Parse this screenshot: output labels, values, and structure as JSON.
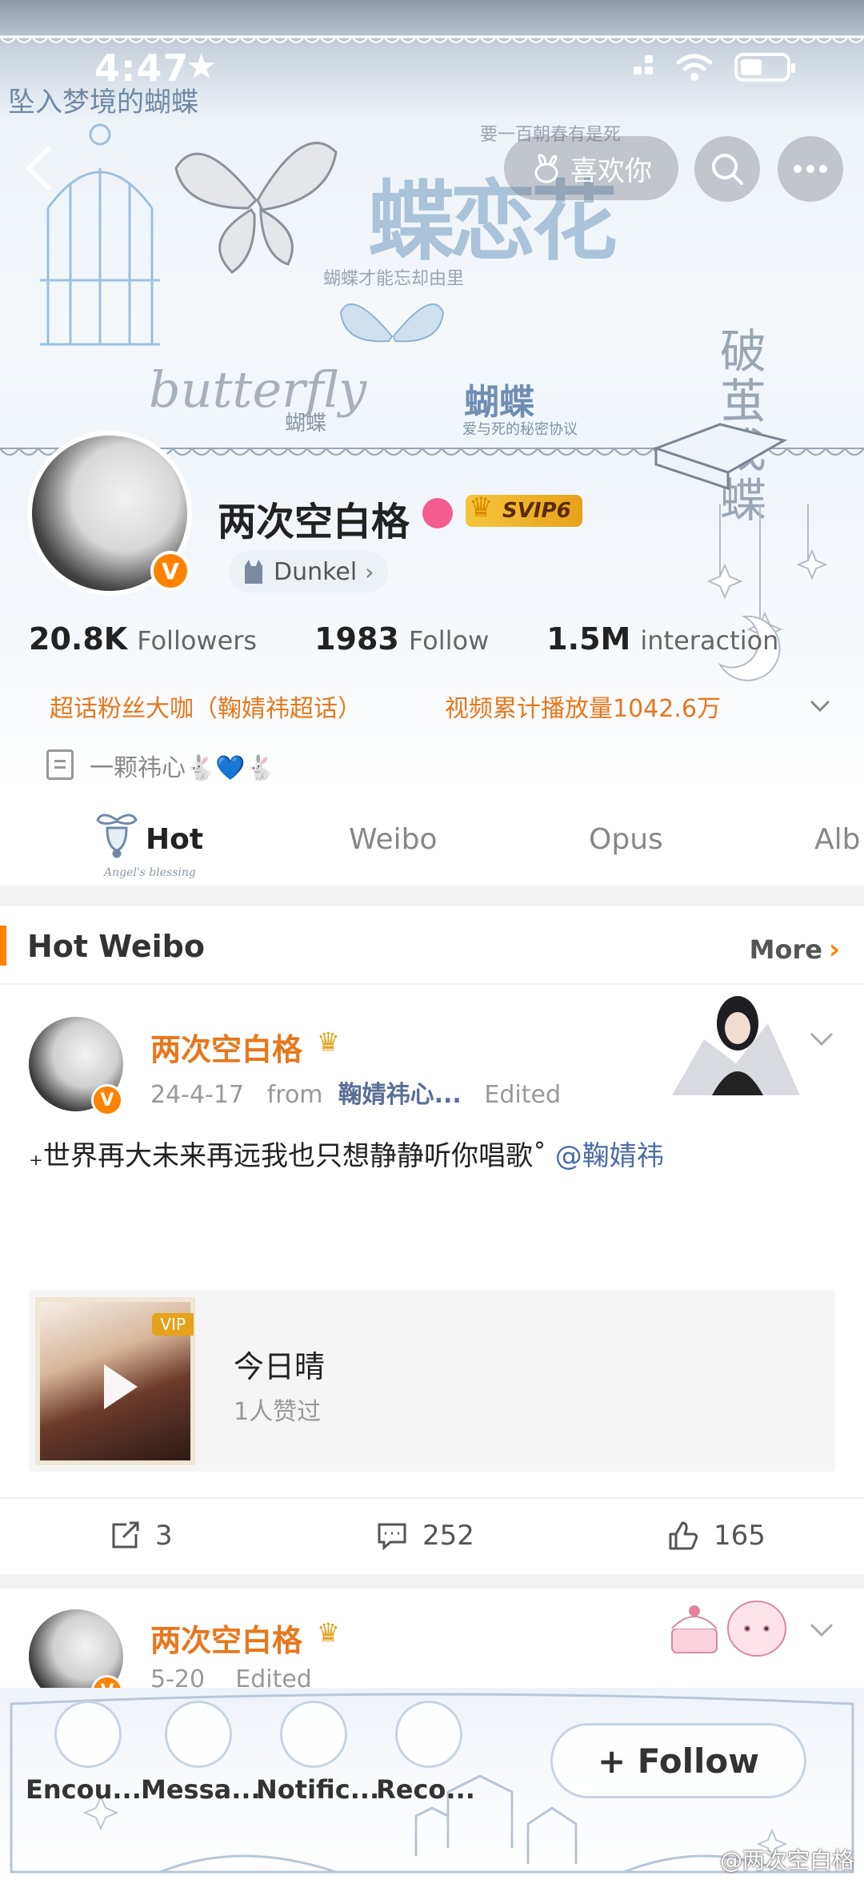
{
  "status_bar": {
    "time": "4:47"
  },
  "header": {
    "like_label": "喜欢你",
    "banner_texts": {
      "top_left": "坠入梦境的蝴蝶",
      "top_right": "要一百朝春有是死",
      "main": "蝶恋花",
      "sub1": "蝴蝶才能忘却由里",
      "cursive": "butterfly",
      "small1": "蝴蝶",
      "small2": "蝴蝶",
      "small2_sub": "爱与死的秘密协议",
      "side": "破茧成蝶"
    }
  },
  "profile": {
    "username": "两次空白格",
    "svip_label": "SVIP6",
    "verify_badge": "V",
    "linked_label": "Dunkel",
    "stats": [
      {
        "value": "20.8K",
        "label": "Followers"
      },
      {
        "value": "1983",
        "label": "Follow"
      },
      {
        "value": "1.5M",
        "label": "interaction"
      }
    ],
    "tags": [
      "超话粉丝大咖（鞠婧祎超话）",
      "视频累计播放量1042.6万"
    ],
    "bio": "一颗祎心🐇💙🐇"
  },
  "tabs": [
    {
      "label": "Hot",
      "sub": "Angel's blessing"
    },
    {
      "label": "Weibo"
    },
    {
      "label": "Opus"
    },
    {
      "label": "Alb"
    }
  ],
  "hot_section": {
    "title": "Hot Weibo",
    "more_label": "More"
  },
  "posts": [
    {
      "author": "两次空白格",
      "date": "24-4-17",
      "from_label": "from",
      "source": "鞠婧祎心...",
      "edited": "Edited",
      "text": "₊世界再大未来再远我也只想静静听你唱歌˚",
      "mention": "@鞠婧祎",
      "media": {
        "title": "今日晴",
        "subtitle": "1人赞过",
        "tag": "VIP"
      },
      "reposts": "3",
      "comments": "252",
      "likes": "165"
    },
    {
      "author": "两次空白格",
      "date": "5-20",
      "edited": "Edited"
    }
  ],
  "bottom_bar": {
    "items": [
      "Encou...",
      "Messa...",
      "Notific...",
      "Reco..."
    ],
    "follow_label": "+ Follow"
  },
  "watermark": "@两次空白格",
  "colors": {
    "accent": "#ff8200",
    "tag": "#e8771c",
    "link": "#4a6da8"
  }
}
